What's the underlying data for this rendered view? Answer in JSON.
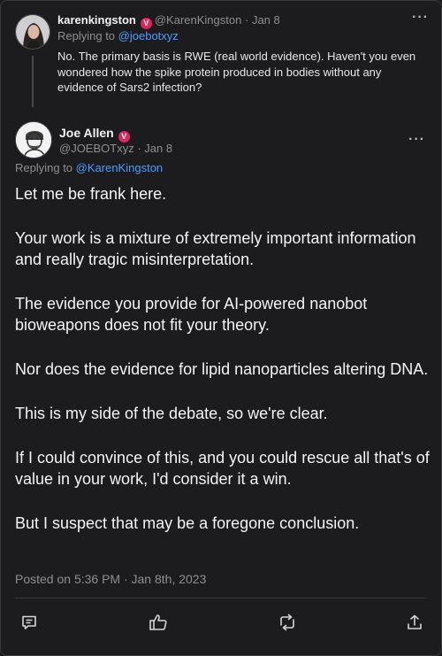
{
  "parent_tweet": {
    "display_name": "karenkingston",
    "handle": "@KarenKingston",
    "separator": "·",
    "date": "Jan 8",
    "replying_to_prefix": "Replying to",
    "replying_to_handle": "@joebotxyz",
    "text": "No. The primary basis is RWE (real world evidence). Haven't you even wondered how the spike protein produced in bodies without any evidence of Sars2 infection?"
  },
  "main_tweet": {
    "display_name": "Joe Allen",
    "handle": "@JOEBOTxyz",
    "separator": "·",
    "date": "Jan 8",
    "replying_to_prefix": "Replying to",
    "replying_to_handle": "@KarenKingston",
    "paragraphs": [
      "Let me be frank here.",
      "Your work is a mixture of extremely important information and really tragic misinterpretation.",
      "The evidence you provide for AI-powered nanobot bioweapons does not fit your theory.",
      "Nor does the evidence for lipid nanoparticles altering DNA.",
      "This is my side of the debate, so we're clear.",
      "If I could convince of this, and you could rescue all that's of value in your work, I'd consider it a win.",
      "But I suspect that may be a foregone conclusion."
    ],
    "posted": "Posted on 5:36 PM · Jan 8th, 2023"
  },
  "badge_glyph": "V",
  "more_glyph": "···",
  "icons": [
    "comment-icon",
    "like-icon",
    "retweet-icon",
    "share-icon",
    "verified-badge-icon",
    "more-options-icon"
  ],
  "colors": {
    "background": "#1c1c1e",
    "link": "#4a9eff",
    "badge": "#e0245e",
    "muted": "#8e8e93"
  }
}
